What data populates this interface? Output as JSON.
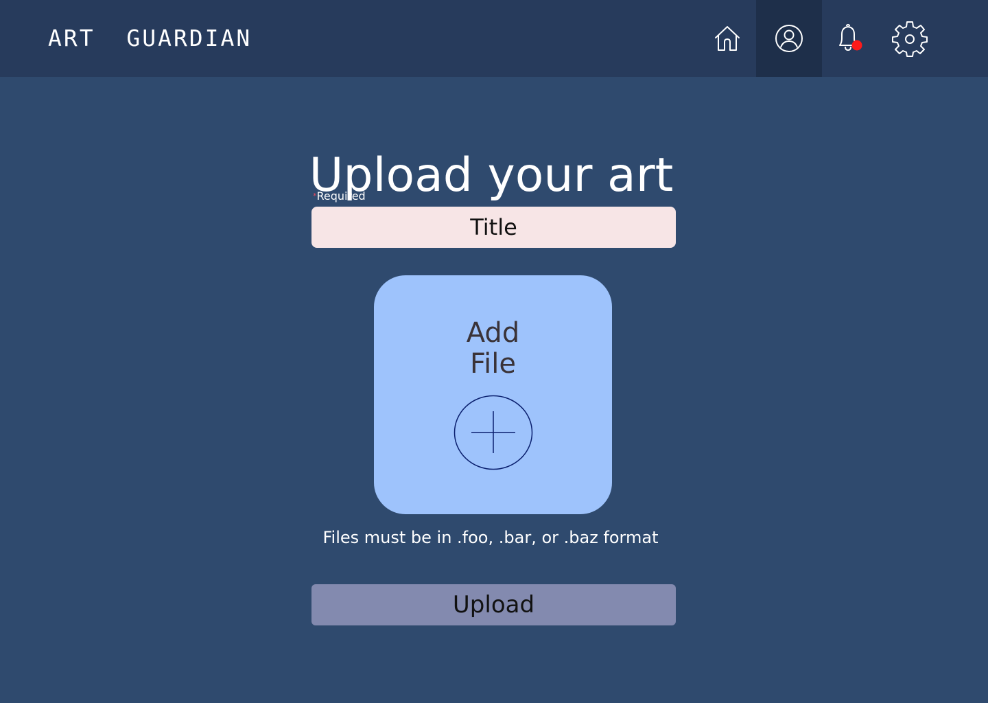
{
  "header": {
    "brand": "ART  GUARDIAN",
    "nav": [
      {
        "icon": "home-icon"
      },
      {
        "icon": "profile-icon",
        "active": true
      },
      {
        "icon": "bell-icon",
        "has_notification": true
      },
      {
        "icon": "gear-icon"
      }
    ]
  },
  "main": {
    "title": "Upload your art",
    "required_marker": "*",
    "required_label": "Required",
    "title_input": {
      "placeholder": "Title",
      "value": ""
    },
    "dropzone": {
      "line1": "Add",
      "line2": "File",
      "icon": "plus-circle-icon"
    },
    "format_hint": "Files must be in .foo, .bar, or .baz format",
    "upload_label": "Upload"
  },
  "colors": {
    "header_bg": "#273b5c",
    "page_bg": "#2f4a6e",
    "active_nav_bg": "#1e2f4a",
    "input_bg": "#f7e5e6",
    "dropzone_bg": "#9ec3fc",
    "upload_bg": "#838aaf",
    "notification_dot": "#ff1a1a",
    "required_star": "#e84a5f"
  }
}
